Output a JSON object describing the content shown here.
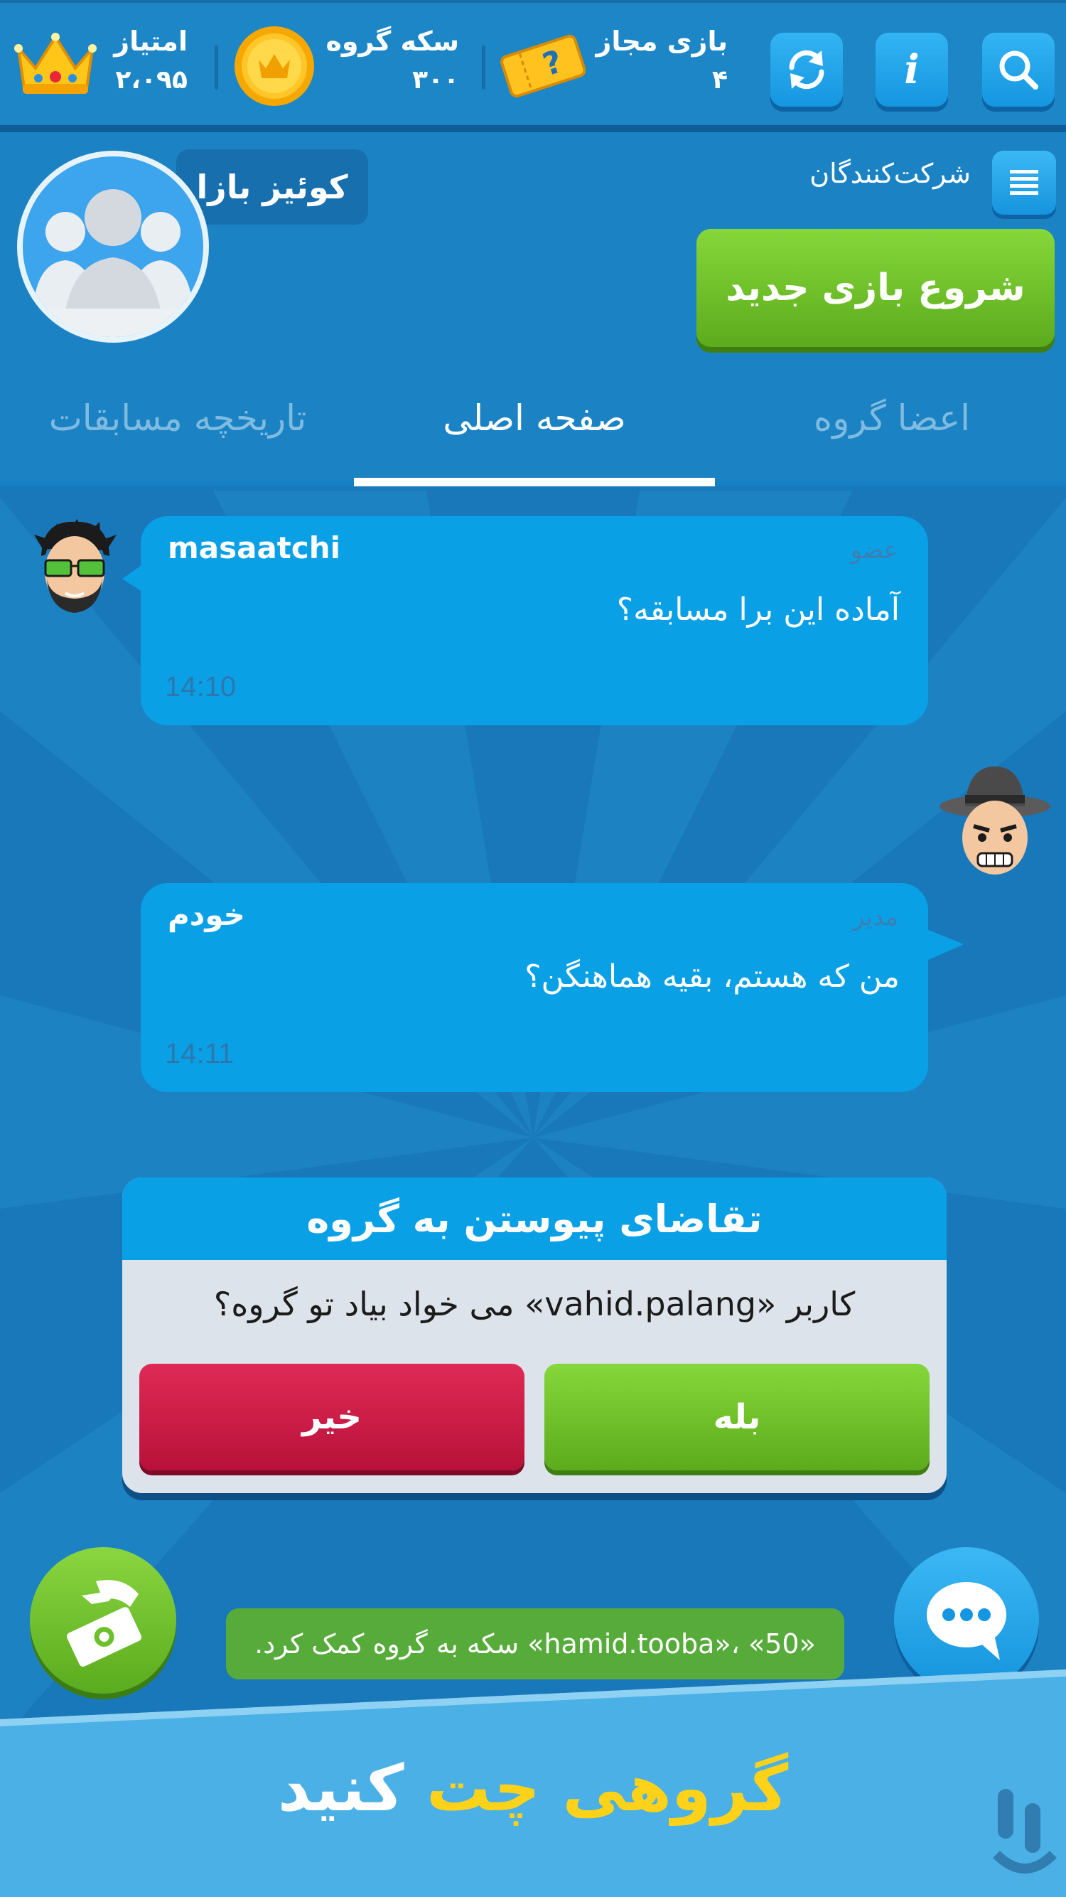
{
  "topbar": {
    "score_label": "امتیاز",
    "score_value": "۲،۰۹۵",
    "coins_label": "سکه گروه",
    "coins_value": "۳۰۰",
    "games_label": "بازی مجاز",
    "games_value": "۴",
    "info_glyph": "i"
  },
  "header": {
    "group_name": "کوئیز بازا",
    "participants_label": "شرکت‌کنندگان",
    "start_button": "شروع بازی جدید"
  },
  "tabs": [
    {
      "label": "اعضا گروه",
      "active": false
    },
    {
      "label": "صفحه اصلی",
      "active": true
    },
    {
      "label": "تاریخچه مسابقات",
      "active": false
    }
  ],
  "messages": [
    {
      "name": "masaatchi",
      "role": "عضو",
      "text": "آماده این برا مسابقه؟",
      "time": "14:10"
    },
    {
      "name": "خودم",
      "role": "مدیر",
      "text": "من که هستم، بقیه هماهنگن؟",
      "time": "14:11"
    }
  ],
  "join_request": {
    "title": "تقاضای پیوستن به گروه",
    "text": "کاربر «vahid.palang» می خواد بیاد تو گروه؟",
    "yes": "بله",
    "no": "خیر"
  },
  "toast": "«hamid.tooba»، «50» سکه به گروه کمک کرد.",
  "promo": {
    "highlight": "گروهی چت",
    "rest": "کنید"
  },
  "colors": {
    "accent_yellow": "#ffd21a",
    "green": "#6cc02a",
    "red": "#c8143f",
    "blue": "#0aa0e6"
  }
}
